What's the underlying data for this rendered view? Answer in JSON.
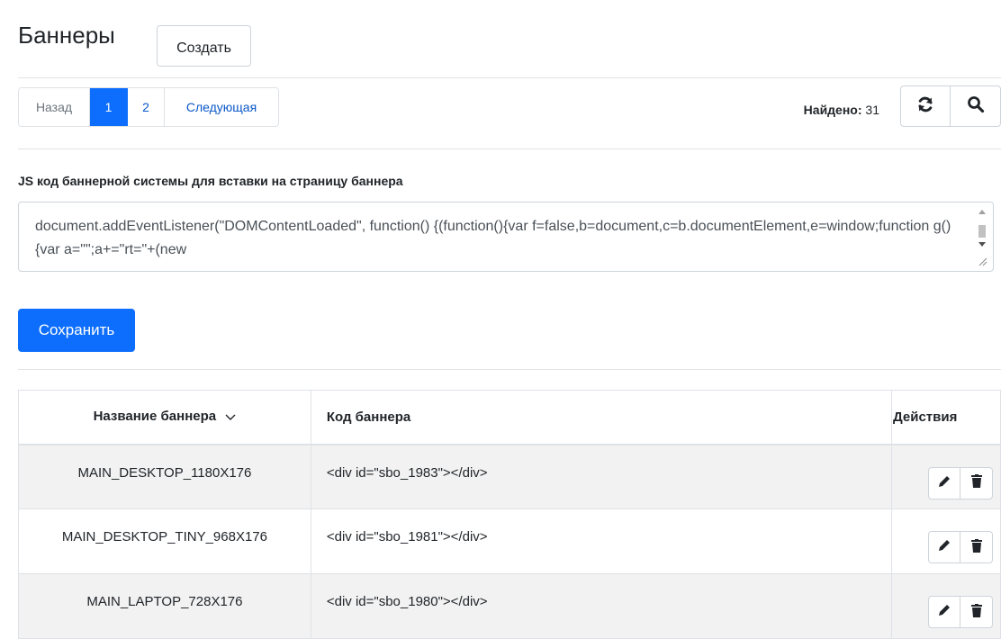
{
  "header": {
    "title": "Баннеры",
    "create_label": "Создать"
  },
  "pagination": {
    "prev_label": "Назад",
    "pages": [
      "1",
      "2"
    ],
    "active_page": "1",
    "next_label": "Следующая"
  },
  "found": {
    "label": "Найдено:",
    "count": "31"
  },
  "toolbar": {
    "icons": [
      "refresh-icon",
      "search-icon"
    ]
  },
  "js_code": {
    "label": "JS код баннерной системы для вставки на страницу баннера",
    "value": "document.addEventListener(\"DOMContentLoaded\", function() {(function(){var f=false,b=document,c=b.documentElement,e=window;function g(){var a=\"\";a+=\"rt=\"+(new"
  },
  "save_label": "Сохранить",
  "table": {
    "headers": {
      "name": "Название баннера",
      "code": "Код баннера",
      "actions": "Действия"
    },
    "sort_icon": "chevron-down-icon",
    "rows": [
      {
        "name": "MAIN_DESKTOP_1180X176",
        "code": "<div id=\"sbo_1983\"></div>"
      },
      {
        "name": "MAIN_DESKTOP_TINY_968X176",
        "code": "<div id=\"sbo_1981\"></div>"
      },
      {
        "name": "MAIN_LAPTOP_728X176",
        "code": "<div id=\"sbo_1980\"></div>"
      }
    ],
    "row_action_icons": [
      "pencil-icon",
      "trash-icon"
    ]
  },
  "colors": {
    "primary": "#0d6efd",
    "link": "#0a58ca",
    "border": "#dee2e6",
    "stripe": "#f2f2f2"
  }
}
